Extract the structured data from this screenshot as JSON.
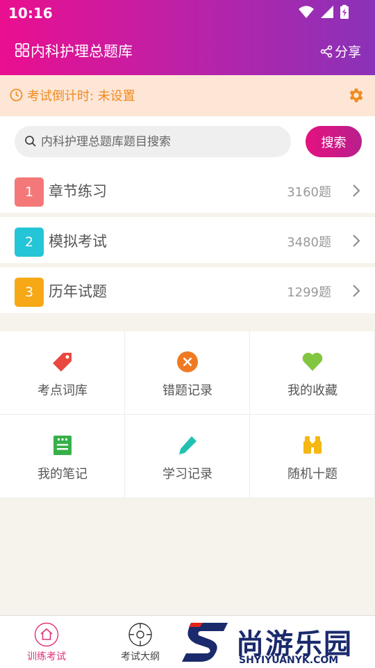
{
  "status": {
    "time": "10:16"
  },
  "header": {
    "title": "内科护理总题库",
    "share_label": "分享"
  },
  "countdown": {
    "text": "考试倒计时: 未设置"
  },
  "search": {
    "placeholder": "内科护理总题库题目搜索",
    "value": "",
    "button_label": "搜索"
  },
  "sections": [
    {
      "num": "1",
      "label": "章节练习",
      "count": "3160题",
      "color": "#f4787a"
    },
    {
      "num": "2",
      "label": "模拟考试",
      "count": "3480题",
      "color": "#25c5d8"
    },
    {
      "num": "3",
      "label": "历年试题",
      "count": "1299题",
      "color": "#f7a816"
    }
  ],
  "tools": [
    {
      "label": "考点词库",
      "icon": "tag-icon",
      "color": "#e9493f"
    },
    {
      "label": "错题记录",
      "icon": "close-circle-icon",
      "color": "#f07a22"
    },
    {
      "label": "我的收藏",
      "icon": "heart-icon",
      "color": "#82c53e"
    },
    {
      "label": "我的笔记",
      "icon": "notebook-icon",
      "color": "#37b04a"
    },
    {
      "label": "学习记录",
      "icon": "pencil-icon",
      "color": "#21c0b0"
    },
    {
      "label": "随机十题",
      "icon": "binoculars-icon",
      "color": "#f5b712"
    }
  ],
  "bottom_nav": [
    {
      "label": "训练考试",
      "icon": "home-icon",
      "active": true
    },
    {
      "label": "考试大纲",
      "icon": "target-icon",
      "active": false
    }
  ],
  "watermark": {
    "title": "尚游乐园",
    "subtitle": "SHYIYUANYK.COM"
  },
  "colors": {
    "accent": "#e1307a",
    "header_start": "#ea0f8f",
    "header_end": "#8a32b8",
    "countdown_bg": "#fde6d6",
    "countdown_text": "#f08a1e"
  }
}
